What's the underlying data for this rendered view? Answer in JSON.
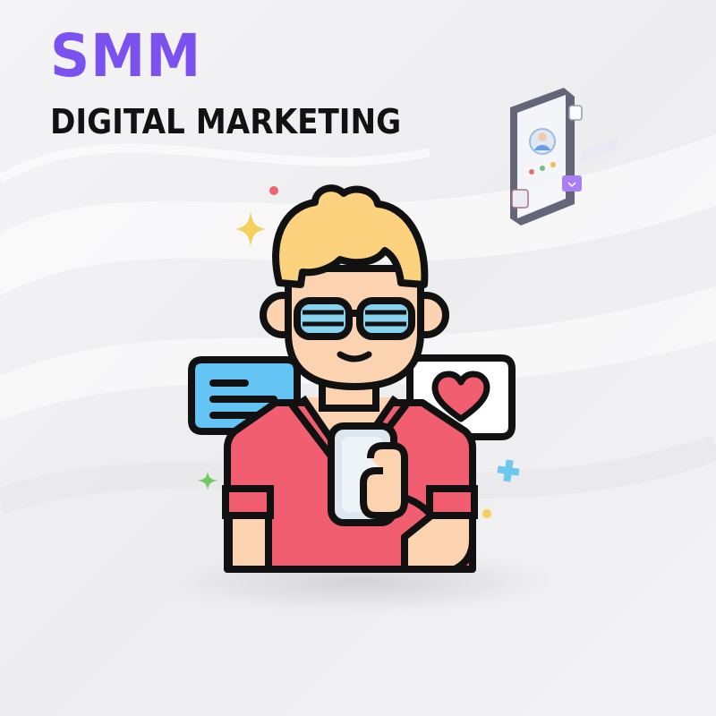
{
  "banner": {
    "title": "SMM",
    "subtitle": "DIGITAL MARKETING"
  },
  "colors": {
    "title": "#7b52f0",
    "subtitle": "#121212",
    "background": "#f0f0f2",
    "hair": "#fcd27f",
    "skin": "#fbd3b1",
    "shirt": "#f15e70",
    "glasses": "#87d4f1",
    "outline": "#111111",
    "chat_bubble": "#64c5f5",
    "heart": "#f15e70",
    "phone": "#dfe7ee"
  },
  "illustration": {
    "subject": "person-with-smartphone",
    "left_bubble_icon": "chat-lines-icon",
    "right_bubble_icon": "heart-icon"
  }
}
